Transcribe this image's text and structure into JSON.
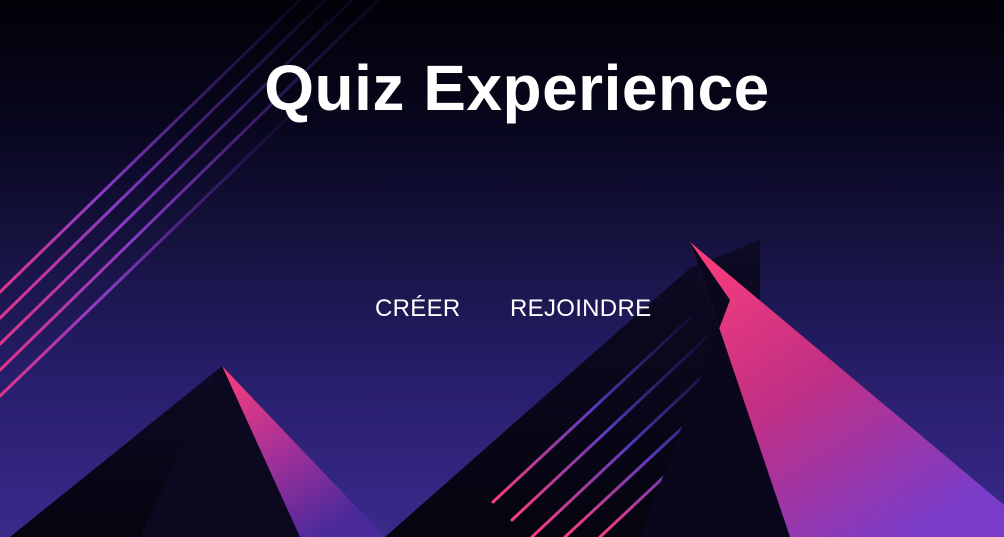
{
  "page": {
    "title": "Quiz Experience"
  },
  "nav": {
    "create_label": "CRÉER",
    "join_label": "REJOINDRE"
  },
  "decor": {
    "moon_icon": "crescent-moon-icon",
    "accent_pink": "#ff3d7a",
    "accent_purple": "#7a3cc8",
    "sky_top": "#020108",
    "sky_bottom": "#3a2a8c"
  }
}
